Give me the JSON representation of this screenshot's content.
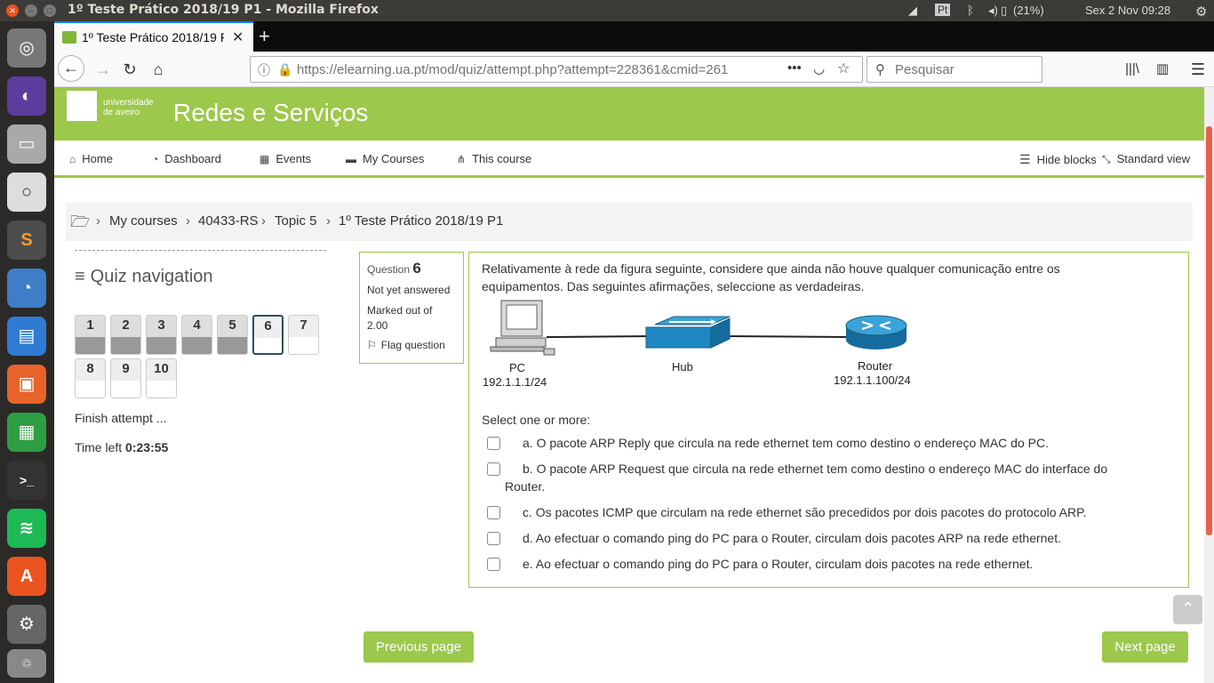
{
  "window": {
    "title": "1º Teste Prático 2018/19 P1 - Mozilla Firefox"
  },
  "tray": {
    "battery": "(21%)",
    "datetime": "Sex  2 Nov 09:28",
    "keyboard": "Pt"
  },
  "browser": {
    "tab_title": "1º Teste Prático 2018/19 P1",
    "url": "https://elearning.ua.pt/mod/quiz/attempt.php?attempt=228361&cmid=261",
    "search_placeholder": "Pesquisar"
  },
  "site": {
    "logo_text_1": "universidade",
    "logo_text_2": "de aveiro",
    "title": "Redes e Serviços"
  },
  "menu": {
    "items": [
      {
        "label": "Home",
        "icon": "home-icon"
      },
      {
        "label": "Dashboard",
        "icon": "dashboard-icon"
      },
      {
        "label": "Events",
        "icon": "calendar-icon"
      },
      {
        "label": "My Courses",
        "icon": "briefcase-icon"
      },
      {
        "label": "This course",
        "icon": "sitemap-icon"
      }
    ],
    "hide_blocks": "Hide blocks",
    "standard_view": "Standard view"
  },
  "breadcrumb": [
    "My courses",
    "40433-RS",
    "Topic 5",
    "1º Teste Prático 2018/19 P1"
  ],
  "quiz_nav": {
    "title": "Quiz navigation",
    "questions": [
      "1",
      "2",
      "3",
      "4",
      "5",
      "6",
      "7",
      "8",
      "9",
      "10"
    ],
    "finish": "Finish attempt ...",
    "time_label": "Time left",
    "time_value": "0:23:55"
  },
  "question_info": {
    "label": "Question",
    "number": "6",
    "status": "Not yet answered",
    "marked": "Marked out of 2.00",
    "flag": "Flag question"
  },
  "question": {
    "text": "Relativamente à rede da figura seguinte, considere que ainda não houve qualquer comunicação entre os equipamentos. Das seguintes afirmações, seleccione as verdadeiras.",
    "figure": {
      "pc_label": "PC",
      "pc_ip": "192.1.1.1/24",
      "hub_label": "Hub",
      "router_label": "Router",
      "router_ip": "192.1.1.100/24"
    },
    "select_prompt": "Select one or more:",
    "answers": [
      "a. O pacote ARP Reply que circula na rede ethernet tem como destino o endereço MAC do PC.",
      "b. O pacote ARP Request que circula na rede ethernet tem como destino o endereço MAC do interface do",
      "Router.",
      "c. Os pacotes ICMP que circulam na rede ethernet são precedidos por dois pacotes do protocolo ARP.",
      "d. Ao efectuar o comando ping do PC para o Router, circulam dois pacotes ARP na rede ethernet.",
      "e. Ao efectuar o comando ping do PC para o Router, circulam dois pacotes na rede ethernet."
    ]
  },
  "pager": {
    "previous": "Previous page",
    "next": "Next page"
  }
}
